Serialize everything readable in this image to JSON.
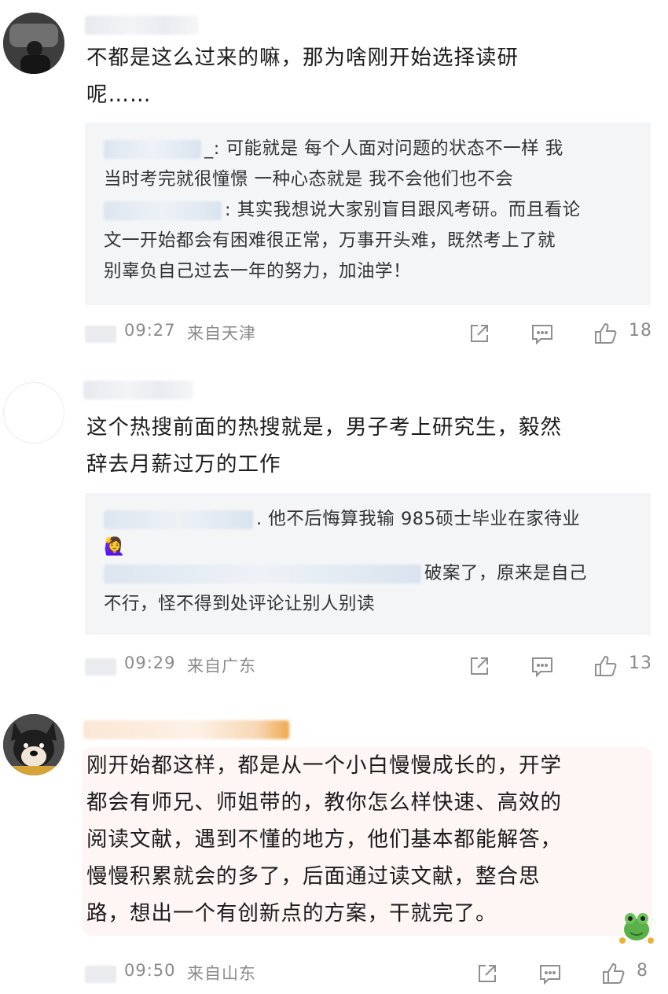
{
  "comments": [
    {
      "body_lines": [
        "不都是这么过来的嘛，那为啥刚开始选择读研",
        "呢……"
      ],
      "replies": [
        {
          "lines": [
            "_: 可能就是 每个人面对问题的状态不一样 我",
            "当时考完就很憧憬 一种心态就是 我不会他们也不会"
          ]
        },
        {
          "lines": [
            ": 其实我想说大家别盲目跟风考研。而且看论",
            "文一开始都会有困难很正常，万事开头难，既然考上了就",
            "别辜负自己过去一年的努力，加油学！"
          ]
        }
      ],
      "time": "09:27",
      "location": "来自天津",
      "likes": "18"
    },
    {
      "body_lines": [
        "这个热搜前面的热搜就是，男子考上研究生，毅然",
        "辞去月薪过万的工作"
      ],
      "replies": [
        {
          "lines": [
            ". 他不后悔算我输 985硕士毕业在家待业"
          ]
        },
        {
          "emoji": "🙋‍♀️",
          "lines": [
            "破案了，原来是自己",
            "不行，怪不得到处评论让别人别读"
          ]
        }
      ],
      "time": "09:29",
      "location": "来自广东",
      "likes": "13"
    },
    {
      "body_lines": [
        "刚开始都这样，都是从一个小白慢慢成长的，开学",
        "都会有师兄、师姐带的，教你怎么样快速、高效的",
        "阅读文献，遇到不懂的地方，他们基本都能解答，",
        "慢慢积累就会的多了，后面通过读文献，整合思",
        "路，想出一个有创新点的方案，干就完了。"
      ],
      "time": "09:50",
      "location": "来自山东",
      "likes": "8"
    }
  ],
  "icons": [
    "share-icon",
    "comment-icon",
    "like-icon"
  ]
}
